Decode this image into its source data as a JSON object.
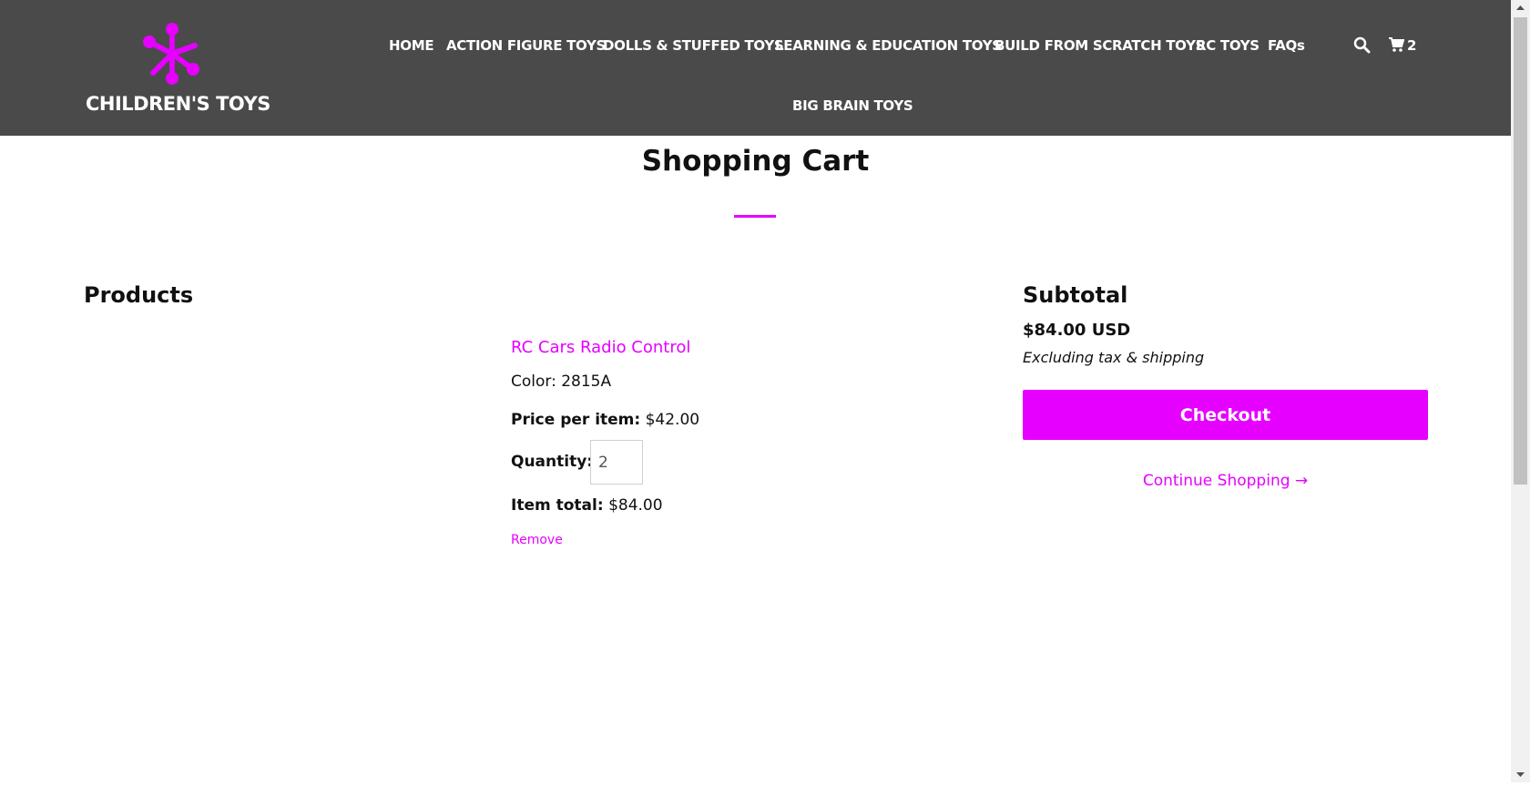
{
  "header": {
    "logo_text": "CHILDREN'S TOYS",
    "nav": [
      "HOME",
      "ACTION FIGURE TOYS",
      "DOLLS & STUFFED TOYS",
      "LEARNING & EDUCATION TOYS",
      "BUILD FROM SCRATCH TOYS",
      "RC TOYS",
      "FAQs",
      "BIG BRAIN TOYS"
    ],
    "cart_count": "2",
    "icons": {
      "search": "search-icon",
      "cart": "cart-icon",
      "logo": "molecule-logo-icon"
    }
  },
  "page": {
    "title": "Shopping Cart"
  },
  "products": {
    "heading": "Products",
    "item": {
      "name": "RC Cars Radio Control",
      "color_line": "Color: 2815A",
      "price_label": "Price per item:",
      "price": "$42.00",
      "quantity_label": "Quantity:",
      "quantity": "2",
      "total_label": "Item total:",
      "total": "$84.00",
      "remove": "Remove"
    }
  },
  "summary": {
    "heading": "Subtotal",
    "amount": "$84.00 USD",
    "note": "Excluding tax & shipping",
    "checkout": "Checkout",
    "continue": "Continue Shopping →"
  },
  "colors": {
    "accent": "#e600ff",
    "header_bg": "#4a4a4a",
    "text": "#111111"
  }
}
